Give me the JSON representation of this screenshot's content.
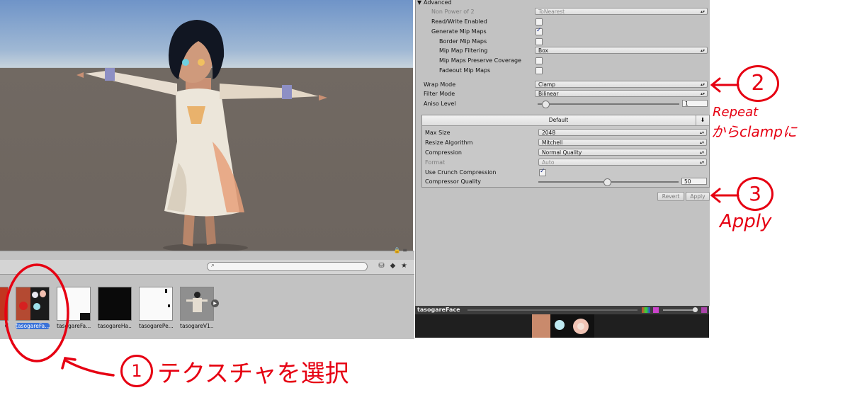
{
  "inspector": {
    "advanced_header": "Advanced",
    "rows": [
      {
        "label": "Non Power of 2",
        "type": "dropdown",
        "value": "ToNearest",
        "dim": true
      },
      {
        "label": "Read/Write Enabled",
        "type": "checkbox",
        "checked": false
      },
      {
        "label": "Generate Mip Maps",
        "type": "checkbox",
        "checked": true
      },
      {
        "label": "Border Mip Maps",
        "type": "checkbox",
        "checked": false
      },
      {
        "label": "Mip Map Filtering",
        "type": "dropdown",
        "value": "Box"
      },
      {
        "label": "Mip Maps Preserve Coverage",
        "type": "checkbox",
        "checked": false
      },
      {
        "label": "Fadeout Mip Maps",
        "type": "checkbox",
        "checked": false
      }
    ],
    "wrap_mode": {
      "label": "Wrap Mode",
      "value": "Clamp"
    },
    "filter_mode": {
      "label": "Filter Mode",
      "value": "Bilinear"
    },
    "aniso_level": {
      "label": "Aniso Level",
      "value": "1"
    },
    "platform": {
      "tab": "Default",
      "max_size": {
        "label": "Max Size",
        "value": "2048"
      },
      "resize_algorithm": {
        "label": "Resize Algorithm",
        "value": "Mitchell"
      },
      "compression": {
        "label": "Compression",
        "value": "Normal Quality"
      },
      "format": {
        "label": "Format",
        "value": "Auto"
      },
      "use_crunch": {
        "label": "Use Crunch Compression",
        "checked": true
      },
      "compressor_quality": {
        "label": "Compressor Quality",
        "value": "50"
      }
    },
    "revert_label": "Revert",
    "apply_label": "Apply"
  },
  "preview": {
    "title": "tasogareFace"
  },
  "browser": {
    "assets": [
      {
        "label": "C",
        "selected": false
      },
      {
        "label": "tasogareFa...",
        "selected": true
      },
      {
        "label": "tasogareFa...",
        "selected": false
      },
      {
        "label": "tasogareHa...",
        "selected": false
      },
      {
        "label": "tasogarePe...",
        "selected": false
      },
      {
        "label": "tasogareV1...",
        "selected": false
      }
    ]
  },
  "annotations": {
    "step2_num": "2",
    "step2_line1": "Repeat",
    "step2_line2": "からclampに",
    "step3_num": "3",
    "step3_text": "Apply",
    "step1_num": "1",
    "step1_text": "テクスチャを選択"
  },
  "colors": {
    "annotation": "#e60012",
    "selection": "#3a72d8",
    "panel": "#c2c2c2"
  }
}
